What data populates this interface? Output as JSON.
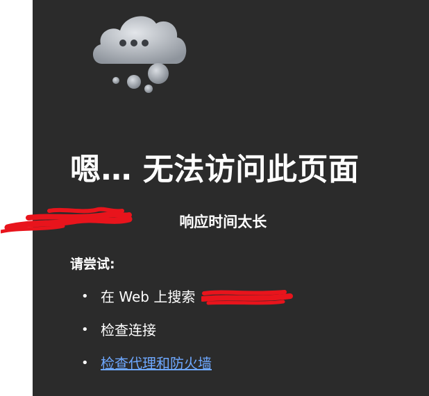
{
  "error": {
    "title": "嗯… 无法访问此页面",
    "host_redacted": "",
    "reason": "响应时间太长",
    "try_label": "请尝试:",
    "suggestions": [
      {
        "bullet": "•",
        "text": "在 Web 上搜索",
        "link_text": ""
      },
      {
        "bullet": "•",
        "text": "检查连接"
      },
      {
        "bullet": "•",
        "link_text": "检查代理和防火墙"
      }
    ]
  },
  "icons": {
    "hero": "cloud-thinking-icon"
  },
  "colors": {
    "background": "#2b2b2b",
    "text": "#ffffff",
    "link": "#6ea8ff",
    "redaction": "#e8141c"
  }
}
